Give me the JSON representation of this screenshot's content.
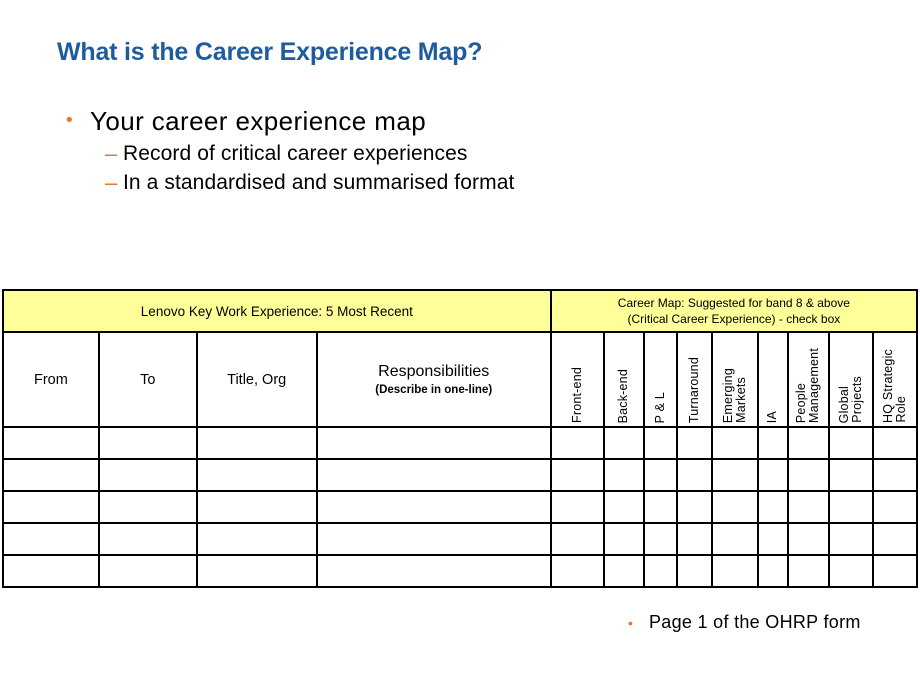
{
  "slide": {
    "title": "What is the Career Experience Map?",
    "title_color": "#1F5C9E",
    "bullet_color": "#E8762C"
  },
  "bullets": [
    {
      "level": 1,
      "marker": "•",
      "text": "Your career experience  map"
    },
    {
      "level": 2,
      "marker": "–",
      "text": "Record of critical career experiences"
    },
    {
      "level": 2,
      "marker": "–",
      "text": "In a standardised and summarised format"
    }
  ],
  "table": {
    "header_bg": "#FFFF99",
    "band_left": "Lenovo Key Work Experience: 5 Most Recent",
    "band_right_line1": "Career Map:  Suggested for band 8 & above",
    "band_right_line2": "(Critical Career Experience) - check box",
    "columns": [
      {
        "label": "From"
      },
      {
        "label": "To"
      },
      {
        "label": "Title, Org"
      },
      {
        "label": "Responsibilities",
        "sub": "(Describe in one-line)"
      }
    ],
    "career_columns": [
      {
        "lines": [
          "Front-end"
        ]
      },
      {
        "lines": [
          "Back-end"
        ]
      },
      {
        "lines": [
          "P & L"
        ]
      },
      {
        "lines": [
          "Turnaround"
        ]
      },
      {
        "lines": [
          "Emerging",
          "Markets"
        ]
      },
      {
        "lines": [
          "IA"
        ]
      },
      {
        "lines": [
          "People",
          "Management"
        ]
      },
      {
        "lines": [
          "Global",
          "Projects"
        ]
      },
      {
        "lines": [
          "HQ Strategic",
          "Role"
        ]
      }
    ],
    "row_count": 5
  },
  "footer": {
    "marker": "•",
    "text": "Page 1 of the OHRP  form"
  }
}
